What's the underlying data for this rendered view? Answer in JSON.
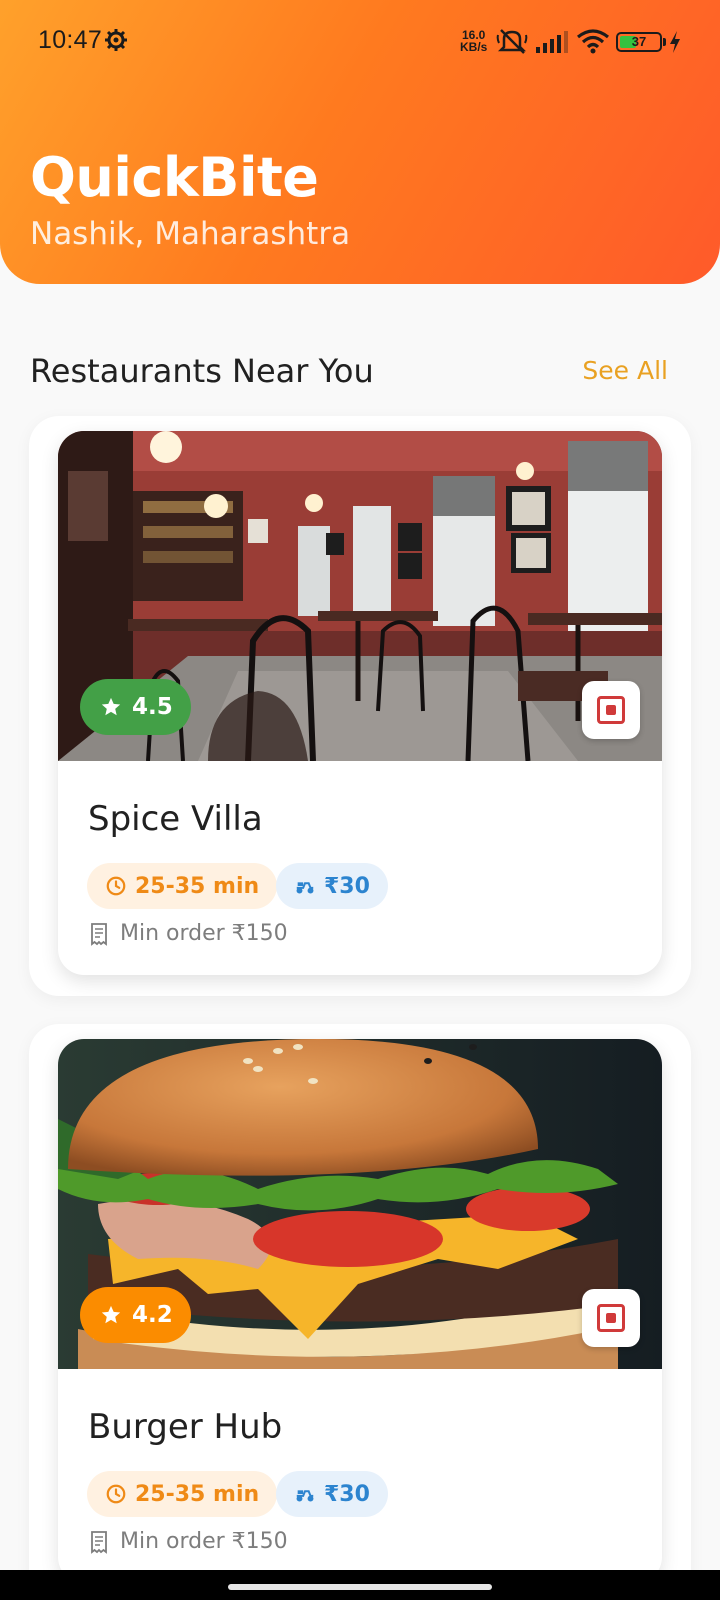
{
  "status_bar": {
    "time": "10:47",
    "net_speed_value": "16.0",
    "net_speed_unit": "KB/s",
    "battery": "37",
    "battery_level": 0.37,
    "icons": [
      "gear-icon",
      "mute-icon",
      "signal-icon",
      "wifi-icon",
      "battery-icon",
      "charging-icon"
    ]
  },
  "header": {
    "title": "QuickBite",
    "location": "Nashik, Maharashtra",
    "gradient_colors": [
      "#ffa12b",
      "#ff5a2a"
    ]
  },
  "section": {
    "title": "Restaurants Near You",
    "see_all": "See All",
    "see_all_color": "#e9a122"
  },
  "restaurants": [
    {
      "name": "Spice Villa",
      "rating": "4.5",
      "rating_color": "#43a047",
      "delivery_time": "25-35 min",
      "delivery_fee": "₹30",
      "min_order": "Min order ₹150",
      "image": "restaurant-interior-photo",
      "food_type_icon": "non-veg-indicator-icon"
    },
    {
      "name": "Burger Hub",
      "rating": "4.2",
      "rating_color": "#fb8c00",
      "delivery_time": "25-35 min",
      "delivery_fee": "₹30",
      "min_order": "Min order ₹150",
      "image": "burger-photo",
      "food_type_icon": "non-veg-indicator-icon"
    }
  ]
}
